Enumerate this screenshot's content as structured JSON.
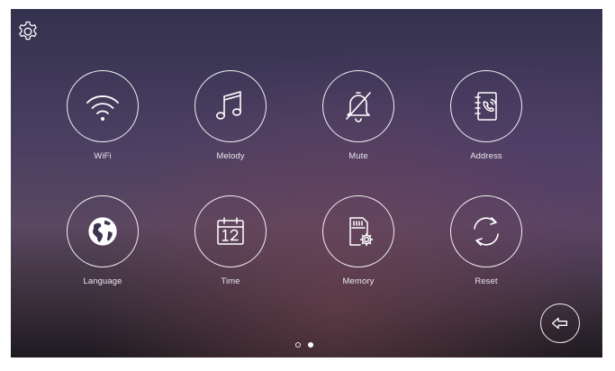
{
  "menu": {
    "items": [
      {
        "label": "WiFi",
        "icon": "wifi-icon"
      },
      {
        "label": "Melody",
        "icon": "music-note-icon"
      },
      {
        "label": "Mute",
        "icon": "bell-off-icon"
      },
      {
        "label": "Address",
        "icon": "address-book-icon"
      },
      {
        "label": "Language",
        "icon": "globe-icon"
      },
      {
        "label": "Time",
        "icon": "calendar-icon"
      },
      {
        "label": "Memory",
        "icon": "memory-card-icon"
      },
      {
        "label": "Reset",
        "icon": "refresh-icon"
      }
    ]
  },
  "toolbar": {
    "settings_icon": "gear-icon",
    "back_icon": "back-arrow-icon"
  },
  "pagination": {
    "current_page": 2,
    "total_pages": 2
  },
  "colors": {
    "icon_stroke": "#ffffff",
    "label": "#e9e6ef"
  }
}
